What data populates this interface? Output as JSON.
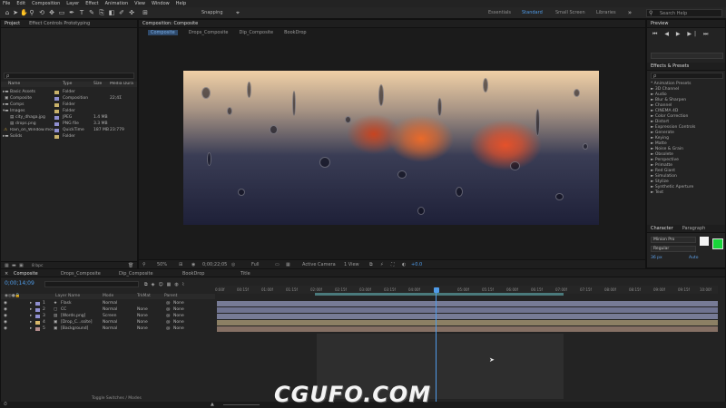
{
  "menubar": [
    "File",
    "Edit",
    "Composition",
    "Layer",
    "Effect",
    "Animation",
    "View",
    "Window",
    "Help"
  ],
  "toolbar": {
    "snapping": "Snapping",
    "workspaces": [
      "Essentials",
      "Standard",
      "Small Screen",
      "Libraries"
    ],
    "active_workspace": "Standard",
    "search_placeholder": "Search Help"
  },
  "project": {
    "tab_project": "Project",
    "tab_effect": "Effect Controls Prototyping",
    "search_placeholder": "ρ",
    "columns": {
      "name": "Name",
      "type": "Type",
      "size": "Size",
      "media_duration": "Media Duration"
    },
    "items": [
      {
        "name": "Basic Assets",
        "type": "Folder",
        "size": "",
        "dur": "",
        "color": "#c9b26a"
      },
      {
        "name": "Composite",
        "type": "Composition",
        "size": "",
        "dur": "22;4Σ",
        "color": "#8f8fd0"
      },
      {
        "name": "Comps",
        "type": "Folder",
        "size": "",
        "dur": "",
        "color": "#c9b26a"
      },
      {
        "name": "Images",
        "type": "Folder",
        "size": "",
        "dur": "",
        "color": "#c9b26a"
      },
      {
        "name": "city_dhaga.jpg",
        "type": "JPEG",
        "size": "1.4 MB",
        "dur": "",
        "color": "#8f8fd0"
      },
      {
        "name": "drops.png",
        "type": "PNG file",
        "size": "3.3 MB",
        "dur": "",
        "color": "#8f8fd0"
      },
      {
        "name": "Rain_on_Window.mov",
        "type": "QuickTime",
        "size": "187 MB",
        "dur": "23:779",
        "color": "#8f8fd0"
      },
      {
        "name": "Solids",
        "type": "Folder",
        "size": "",
        "dur": "",
        "color": "#c9b26a"
      }
    ],
    "bpc": "8 bpc"
  },
  "viewer": {
    "tab_title": "Composition: Composite",
    "breadcrumbs": [
      "Composite",
      "Drops_Composite",
      "Dip_Composite",
      "BookDrop"
    ],
    "zoom": "50%",
    "timecode": "0;00;22;05",
    "resolution": "Full",
    "camera": "Active Camera",
    "views": "1 View",
    "offset": "+0.0"
  },
  "preview": {
    "title": "Preview"
  },
  "effects": {
    "title": "Effects & Presets",
    "search_placeholder": "ρ",
    "items": [
      "* Animation Presets",
      "► 3D Channel",
      "► Audio",
      "► Blur & Sharpen",
      "► Channel",
      "► CINEMA 4D",
      "► Color Correction",
      "► Distort",
      "► Expression Controls",
      "► Generate",
      "► Keying",
      "► Matte",
      "► Noise & Grain",
      "► Obsolete",
      "► Perspective",
      "► Primatte",
      "► Red Giant",
      "► Simulation",
      "► Stylize",
      "► Synthetic Aperture",
      "► Text"
    ]
  },
  "character": {
    "title": "Character",
    "paragraph": "Paragraph",
    "font": "Minion Pro",
    "style": "Regular",
    "size": "36 px",
    "leading": "Auto"
  },
  "timeline": {
    "tabs": [
      "Composite",
      "Drops_Composite",
      "Dip_Composite",
      "BookDrop",
      "Title"
    ],
    "timecode": "0;00;14;09",
    "columns": {
      "source": "Layer Name",
      "mode": "Mode",
      "trkmat": "TrkMat",
      "parent": "Parent"
    },
    "layers": [
      {
        "num": "1",
        "name": "Flask",
        "mode": "Normal",
        "trk": "",
        "parent": "None",
        "color": "#8f8fd0"
      },
      {
        "num": "2",
        "name": "CC",
        "mode": "Normal",
        "trk": "None",
        "parent": "None",
        "color": "#8f8fd0"
      },
      {
        "num": "3",
        "name": "[Words.png]",
        "mode": "Screen",
        "trk": "None",
        "parent": "None",
        "color": "#8f8fd0"
      },
      {
        "num": "4",
        "name": "[Drop_C...ssite]",
        "mode": "Normal",
        "trk": "None",
        "parent": "None",
        "color": "#d9b86a"
      },
      {
        "num": "5",
        "name": "[Background]",
        "mode": "Normal",
        "trk": "None",
        "parent": "None",
        "color": "#b38c8c"
      }
    ],
    "ruler": [
      "0:00f",
      "00:15f",
      "01:00f",
      "01:15f",
      "02:00f",
      "02:15f",
      "03:00f",
      "03:15f",
      "04:00f",
      "04:15f",
      "05:00f",
      "05:15f",
      "06:00f",
      "06:15f",
      "07:00f",
      "07:15f",
      "08:00f",
      "08:15f",
      "09:00f",
      "09:15f",
      "10:00f"
    ],
    "toggle": "Toggle Switches / Modes"
  },
  "watermark": "CGUFO.COM"
}
